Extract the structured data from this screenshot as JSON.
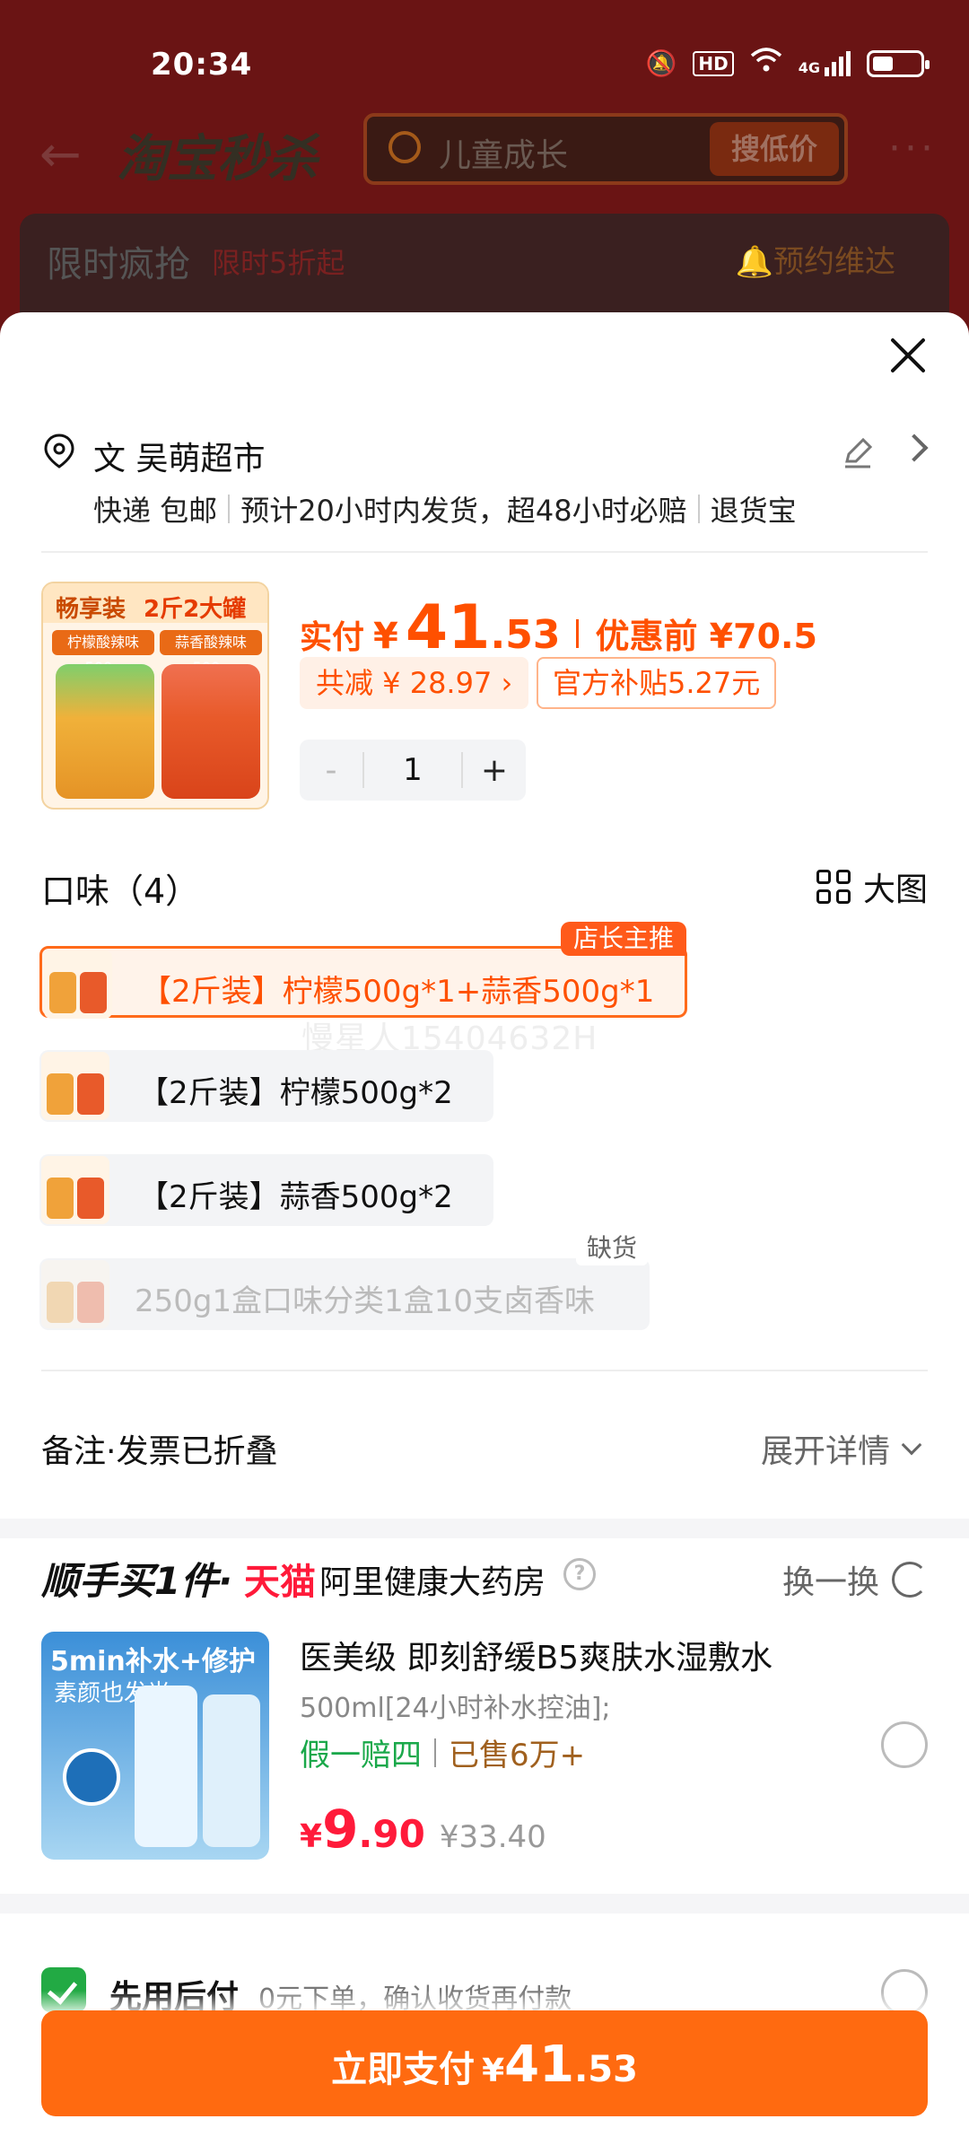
{
  "status": {
    "time": "20:34",
    "hd": "HD",
    "net": "4G"
  },
  "background": {
    "logo": "淘宝秒杀",
    "search_placeholder": "儿童成长",
    "search_button": "搜低价",
    "more": "···",
    "card_title": "限时疯抢",
    "card_sub": "限时5折起",
    "card_remind": "🔔预约维达"
  },
  "sheet": {
    "address": "文 吴萌超市",
    "delivery": [
      "快递 包邮",
      "预计20小时内发货，超48小时必赔",
      "退货宝"
    ],
    "product": {
      "img_title1": "畅享装",
      "img_title2": "2斤2大罐",
      "img_tag1": "柠檬酸辣味500g",
      "img_tag2": "蒜香酸辣味500g",
      "price_label": "实付",
      "currency": "¥",
      "price_int": "41",
      "price_dec": ".53",
      "price_before": "优惠前 ¥70.5",
      "save": "共减 ¥ 28.97 ›",
      "subsidy": "官方补贴5.27元",
      "qty_minus": "-",
      "qty": "1",
      "qty_plus": "+"
    },
    "flavor": {
      "title": "口味（4）",
      "bigpic": "大图",
      "options": [
        {
          "label": "【2斤装】柠檬500g*1+蒜香500g*1",
          "badge": "店长主推"
        },
        {
          "label": "【2斤装】柠檬500g*2"
        },
        {
          "label": "【2斤装】蒜香500g*2"
        },
        {
          "label": "250g1盒口味分类1盒10支卤香味",
          "badge": "缺货"
        }
      ]
    },
    "watermark": "慢星人15404632H",
    "notes": {
      "label": "备注·发票已折叠",
      "expand": "展开详情"
    },
    "addon": {
      "brand": "顺手买1件·",
      "tmall": "天猫",
      "store": "阿里健康大药房",
      "help": "?",
      "swap": "换一换",
      "img_t1": "5min补水+修护",
      "img_t2": "素颜也发光",
      "title": "医美级 即刻舒缓B5爽肤水湿敷水",
      "spec": "500ml[24小时补水控油];",
      "tag1": "假一赔四",
      "tag2": "已售6万+",
      "currency": "¥",
      "price_int": "9",
      "price_dec": ".90",
      "orig_price": "¥33.40"
    },
    "pay_later": {
      "title": "先用后付",
      "desc": "0元下单，确认收货再付款"
    },
    "pay_button": {
      "label": "立即支付",
      "currency": "¥",
      "int": "41",
      "dec": ".53"
    }
  },
  "colors": {
    "accent": "#ff5000",
    "pay_button": "#ff6a10",
    "tmall_red": "#ff1a3a"
  }
}
